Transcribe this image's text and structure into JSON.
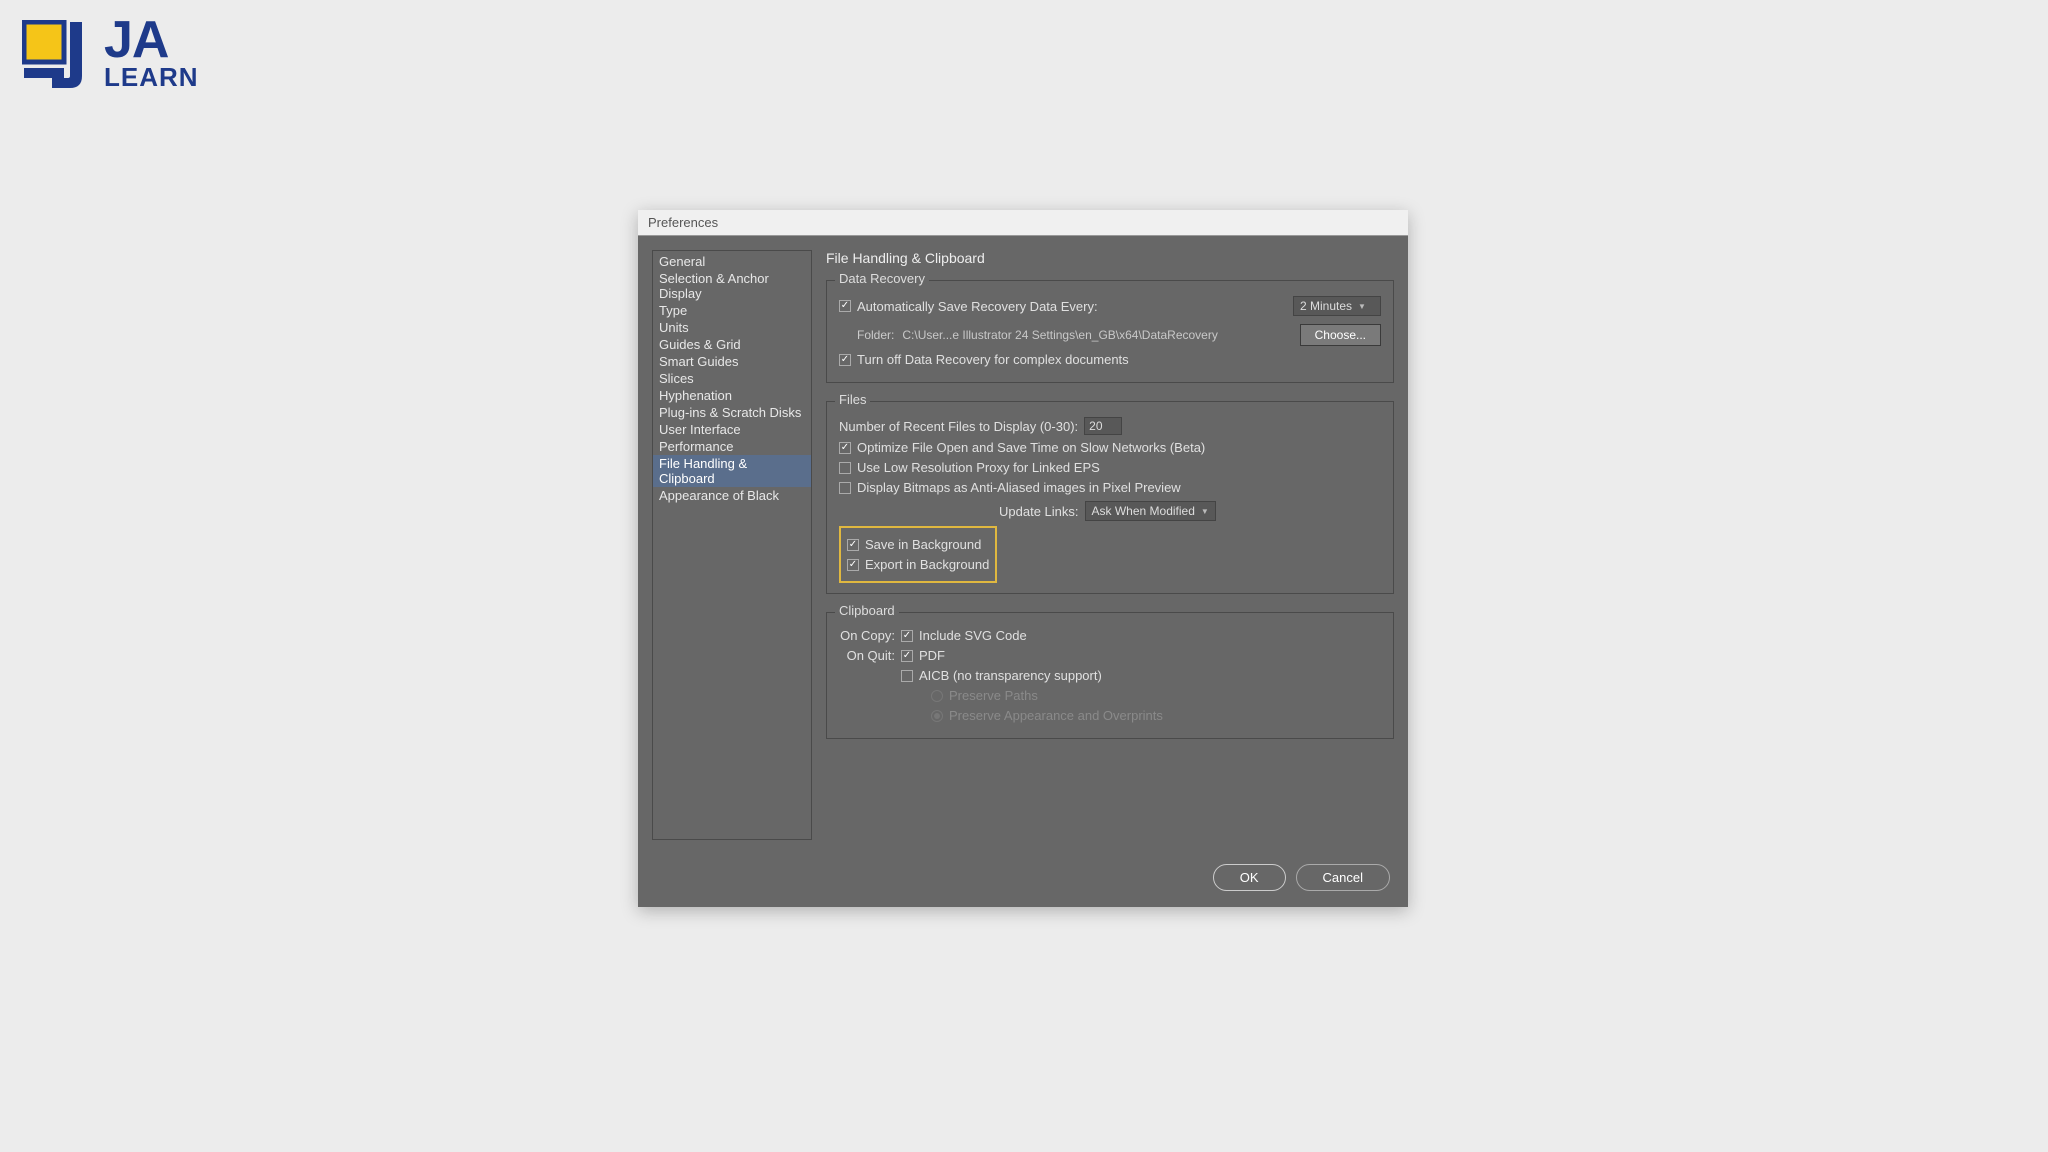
{
  "logo": {
    "top": "JA",
    "bottom": "LEARN"
  },
  "dialog": {
    "title": "Preferences",
    "panel_title": "File Handling & Clipboard",
    "sidebar": [
      "General",
      "Selection & Anchor Display",
      "Type",
      "Units",
      "Guides & Grid",
      "Smart Guides",
      "Slices",
      "Hyphenation",
      "Plug-ins & Scratch Disks",
      "User Interface",
      "Performance",
      "File Handling & Clipboard",
      "Appearance of Black"
    ],
    "selected_index": 11,
    "data_recovery": {
      "section": "Data Recovery",
      "auto_save": "Automatically Save Recovery Data Every:",
      "interval": "2 Minutes",
      "folder_label": "Folder:",
      "folder_path": "C:\\User...e Illustrator 24 Settings\\en_GB\\x64\\DataRecovery",
      "choose": "Choose...",
      "turn_off": "Turn off Data Recovery for complex documents"
    },
    "files": {
      "section": "Files",
      "recent_label": "Number of Recent Files to Display (0-30):",
      "recent_value": "20",
      "optimize": "Optimize File Open and Save Time on Slow Networks (Beta)",
      "low_res": "Use Low Resolution Proxy for Linked EPS",
      "bitmaps": "Display Bitmaps as Anti-Aliased images in Pixel Preview",
      "update_links_label": "Update Links:",
      "update_links_value": "Ask When Modified",
      "save_bg": "Save in Background",
      "export_bg": "Export in Background"
    },
    "clipboard": {
      "section": "Clipboard",
      "on_copy": "On Copy:",
      "include_svg": "Include SVG Code",
      "on_quit": "On Quit:",
      "pdf": "PDF",
      "aicb": "AICB (no transparency support)",
      "preserve_paths": "Preserve Paths",
      "preserve_appearance": "Preserve Appearance and Overprints"
    },
    "buttons": {
      "ok": "OK",
      "cancel": "Cancel"
    }
  }
}
